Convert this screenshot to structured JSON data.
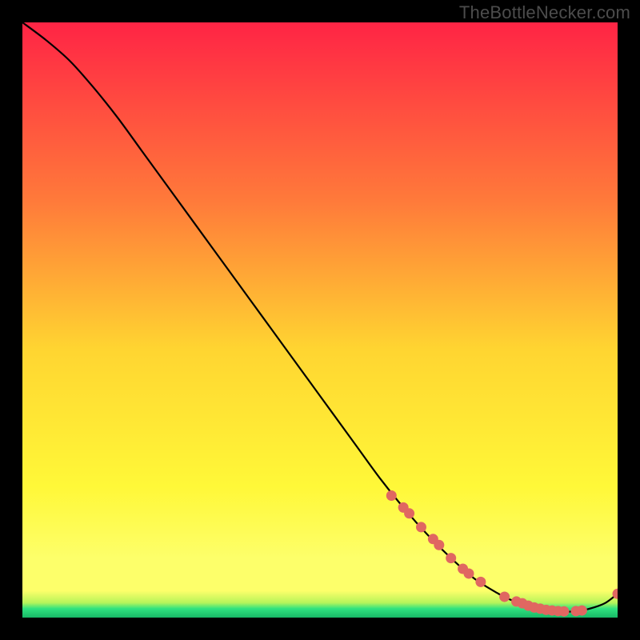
{
  "watermark": "TheBottleNecker.com",
  "colors": {
    "grad_top": "#ff2445",
    "grad_mid1": "#ff7a3a",
    "grad_mid2": "#ffd531",
    "grad_mid3": "#fff838",
    "grad_bottom_yellow": "#fdff6a",
    "grad_green": "#2fe37f",
    "curve": "#000000",
    "marker": "#e06761",
    "bg": "#000000"
  },
  "chart_data": {
    "type": "line",
    "title": "",
    "xlabel": "",
    "ylabel": "",
    "xlim": [
      0,
      100
    ],
    "ylim": [
      0,
      100
    ],
    "grid": false,
    "legend": false,
    "series": [
      {
        "name": "bottleneck-curve",
        "x": [
          0,
          4,
          8,
          12,
          16,
          20,
          24,
          28,
          32,
          36,
          40,
          44,
          48,
          52,
          56,
          60,
          64,
          68,
          72,
          76,
          80,
          82,
          84,
          86,
          88,
          90,
          92,
          94,
          96,
          98,
          100
        ],
        "y": [
          100,
          97,
          93.5,
          89,
          84,
          78.5,
          73,
          67.5,
          62,
          56.5,
          51,
          45.5,
          40,
          34.5,
          29,
          23.5,
          18.5,
          14,
          10,
          6.5,
          4,
          3,
          2.2,
          1.6,
          1.2,
          1.0,
          1.0,
          1.2,
          1.7,
          2.5,
          4
        ]
      }
    ],
    "markers": {
      "name": "highlight-points",
      "x": [
        62,
        64,
        65,
        67,
        69,
        70,
        72,
        74,
        75,
        77,
        81,
        83,
        84,
        85,
        86,
        87,
        88,
        89,
        90,
        91,
        93,
        94,
        100
      ],
      "y": [
        20.5,
        18.5,
        17.5,
        15.2,
        13.2,
        12.2,
        10,
        8.2,
        7.4,
        6,
        3.5,
        2.7,
        2.4,
        2.0,
        1.7,
        1.5,
        1.3,
        1.2,
        1.1,
        1.05,
        1.1,
        1.2,
        4
      ]
    }
  }
}
